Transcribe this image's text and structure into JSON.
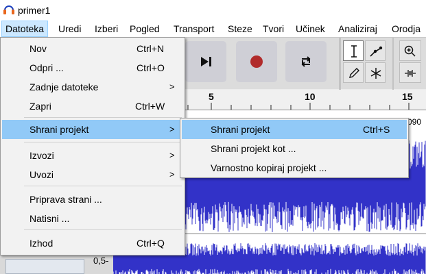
{
  "window": {
    "title": "primer1"
  },
  "menubar": [
    "Datoteka",
    "Uredi",
    "Izberi",
    "Pogled",
    "Transport",
    "Steze",
    "Tvori",
    "Učinek",
    "Analiziraj",
    "Orodja"
  ],
  "file_menu": [
    {
      "label": "Nov",
      "accel": "Ctrl+N"
    },
    {
      "label": "Odpri ...",
      "accel": "Ctrl+O"
    },
    {
      "label": "Zadnje datoteke",
      "submenu": true
    },
    {
      "label": "Zapri",
      "accel": "Ctrl+W"
    },
    {
      "label": "Shrani projekt",
      "submenu": true
    },
    {
      "label": "Izvozi",
      "submenu": true
    },
    {
      "label": "Uvozi",
      "submenu": true
    },
    {
      "label": "Priprava strani ..."
    },
    {
      "label": "Natisni ..."
    },
    {
      "label": "Izhod",
      "accel": "Ctrl+Q"
    }
  ],
  "save_submenu": [
    {
      "label": "Shrani projekt",
      "accel": "Ctrl+S"
    },
    {
      "label": "Shrani projekt kot ..."
    },
    {
      "label": "Varnostno kopiraj projekt ..."
    }
  ],
  "ruler": {
    "labels": [
      "5",
      "10",
      "15"
    ]
  },
  "track": {
    "amplitude_label": "0,5-",
    "header_value": "090"
  },
  "colors": {
    "accent": "#91c9f7",
    "waveform": "#3232c8",
    "record": "#b12b2b"
  },
  "icons": {
    "play_end": "skip-to-end-icon",
    "record": "record-icon",
    "loop": "loop-icon",
    "select_tool": "text-cursor-icon",
    "envelope_tool": "envelope-icon",
    "draw_tool": "pencil-icon",
    "multi_tool": "asterisk-icon",
    "zoom": "zoom-in-icon",
    "silence": "silence-icon"
  }
}
